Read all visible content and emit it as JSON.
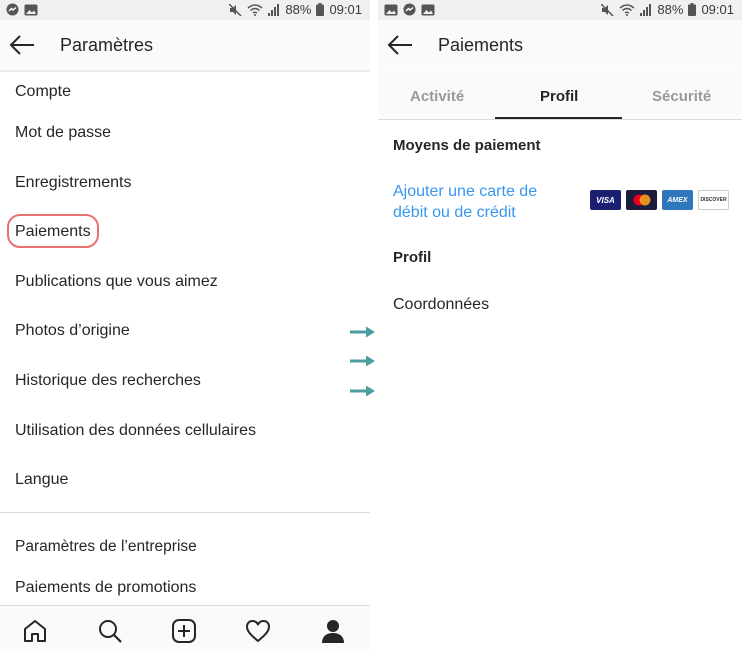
{
  "status_bar": {
    "battery": "88%",
    "time": "09:01"
  },
  "left_screen": {
    "title": "Paramètres",
    "section_account": "Compte",
    "items": [
      "Mot de passe",
      "Enregistrements",
      "Paiements",
      "Publications que vous aimez",
      "Photos d’origine",
      "Historique des recherches",
      "Utilisation des données cellulaires",
      "Langue"
    ],
    "business_section": "Paramètres de l’entreprise",
    "promotions": "Paiements de promotions"
  },
  "right_screen": {
    "title": "Paiements",
    "tabs": [
      "Activité",
      "Profil",
      "Sécurité"
    ],
    "active_tab": "Profil",
    "payment_methods_heading": "Moyens de paiement",
    "add_card_line1": "Ajouter une carte de",
    "add_card_line2": "débit ou de crédit",
    "cards": [
      "VISA",
      "MC",
      "AMEX",
      "DISCOVER"
    ],
    "profile_heading": "Profil",
    "contact_item": "Coordonnées"
  },
  "colors": {
    "highlight": "#e8716f",
    "link": "#3897f0",
    "arrow": "#4a9ea0",
    "visa": "#1a1f71",
    "amex": "#2e77bc"
  },
  "icons": [
    "back-arrow-icon",
    "home-icon",
    "search-icon",
    "new-post-icon",
    "heart-icon",
    "profile-icon",
    "wifi-icon",
    "signal-icon",
    "battery-icon",
    "mute-icon"
  ]
}
